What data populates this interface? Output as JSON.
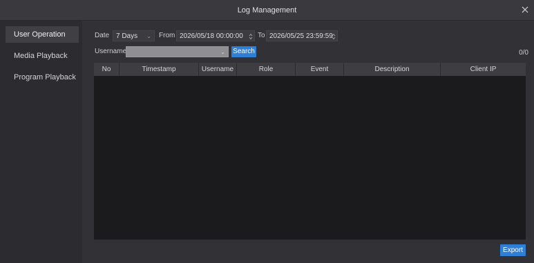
{
  "window": {
    "title": "Log Management"
  },
  "sidebar": {
    "items": [
      {
        "label": "User Operation"
      },
      {
        "label": "Media Playback"
      },
      {
        "label": "Program Playback"
      }
    ]
  },
  "filters": {
    "date_label": "Date",
    "date_range": "7 Days",
    "from_label": "From",
    "from_value": "2026/05/18 00:00:00",
    "to_label": "To",
    "to_value": "2026/05/25 23:59:59",
    "username_label": "Username",
    "username_value": "",
    "search_label": "Search"
  },
  "record_count": "0/0",
  "table": {
    "columns": [
      "No",
      "Timestamp",
      "Username",
      "Role",
      "Event",
      "Description",
      "Client IP"
    ],
    "rows": []
  },
  "footer": {
    "export_label": "Export"
  },
  "colors": {
    "accent": "#2f7fd6",
    "background": "#2a2a2e",
    "table_body": "#1b1b1e"
  }
}
